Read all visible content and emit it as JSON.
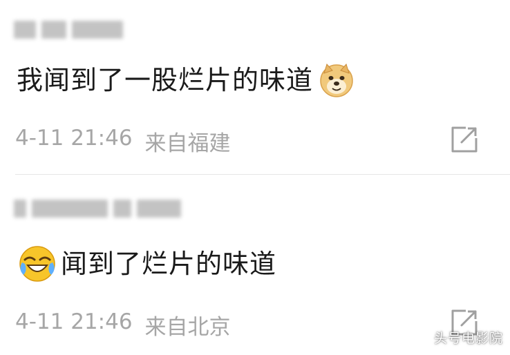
{
  "comments": [
    {
      "text": "我闻到了一股烂片的味道",
      "emoji": "doge-emoji",
      "time": "4-11 21:46",
      "location": "来自福建",
      "share_icon": "share-icon"
    },
    {
      "text": "闻到了烂片的味道",
      "emoji": "laugh-cry-emoji",
      "time": "4-11 21:46",
      "location": "来自北京",
      "share_icon": "share-icon"
    }
  ],
  "watermark": "头号电影院",
  "colors": {
    "text": "#1a1a1a",
    "meta": "#a6a6a6",
    "divider": "#e6e6e6",
    "icon": "#a0a0a0"
  }
}
